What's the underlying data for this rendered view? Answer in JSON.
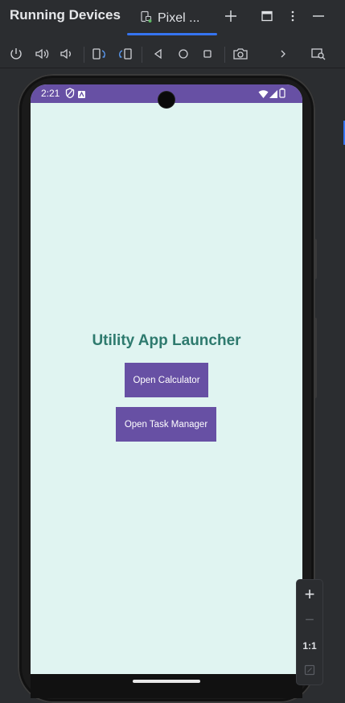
{
  "header": {
    "title": "Running Devices",
    "tab_label": "Pixel ..."
  },
  "toolbar": {
    "items": [
      "power-icon",
      "volume-up-icon",
      "volume-down-icon",
      "rotate-left-icon",
      "rotate-right-icon",
      "back-icon",
      "home-icon",
      "overview-icon",
      "screenshot-icon",
      "more-icon",
      "inspect-icon"
    ]
  },
  "device": {
    "status_time": "2:21",
    "app_title": "Utility App Launcher",
    "buttons": {
      "calculator": "Open Calculator",
      "task_manager": "Open Task Manager"
    }
  },
  "zoom": {
    "zoom_in": "+",
    "zoom_out": "−",
    "actual_size": "1:1"
  },
  "colors": {
    "accent": "#3574f0",
    "app_primary": "#6750a4",
    "app_background": "#e0f4f1",
    "title_color": "#2e7a6e"
  }
}
